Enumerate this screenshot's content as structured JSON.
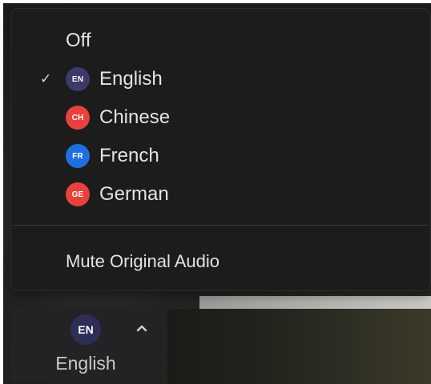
{
  "menu": {
    "off_label": "Off",
    "languages": [
      {
        "code": "EN",
        "label": "English",
        "color": "#3b3a6a",
        "selected": true
      },
      {
        "code": "CH",
        "label": "Chinese",
        "color": "#e8413c",
        "selected": false
      },
      {
        "code": "FR",
        "label": "French",
        "color": "#1f6fe0",
        "selected": false
      },
      {
        "code": "GE",
        "label": "German",
        "color": "#e8413c",
        "selected": false
      }
    ],
    "check_glyph": "✓",
    "mute_label": "Mute Original Audio"
  },
  "toolbar": {
    "badge_code": "EN",
    "label": "English",
    "badge_color": "#2f2e57"
  }
}
